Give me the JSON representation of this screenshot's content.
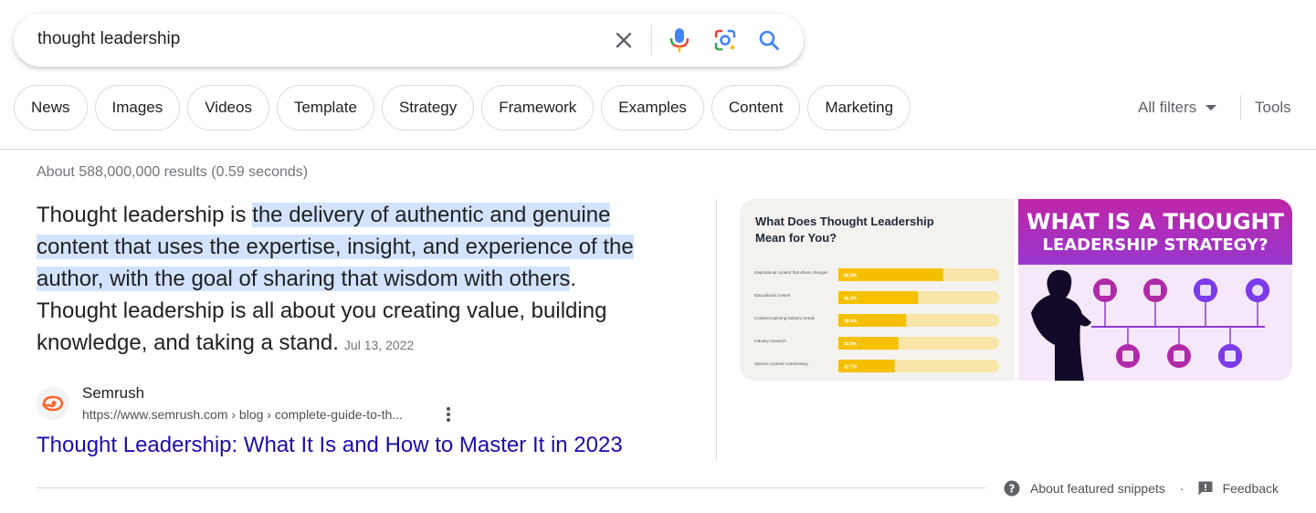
{
  "search": {
    "query": "thought leadership"
  },
  "chips": [
    "News",
    "Images",
    "Videos",
    "Template",
    "Strategy",
    "Framework",
    "Examples",
    "Content",
    "Marketing"
  ],
  "toolbar": {
    "all_filters": "All filters",
    "tools": "Tools"
  },
  "results_stats": "About 588,000,000 results (0.59 seconds)",
  "snippet": {
    "intro": "Thought leadership is ",
    "highlight_1": "the delivery of authentic and genuine",
    "highlight_2": "content that uses the expertise, insight, and experience of the",
    "highlight_3": "author, with the goal of sharing that wisdom with others",
    "after_highlight": ".",
    "line_4": "Thought leadership is all about you creating value, building",
    "line_5": "knowledge, and taking a stand.",
    "date": "Jul 13, 2022"
  },
  "source": {
    "site_name": "Semrush",
    "url": "https://www.semrush.com › blog › complete-guide-to-th...",
    "title": "Thought Leadership: What It Is and How to Master It in 2023"
  },
  "image_left": {
    "heading": "What Does Thought Leadership Mean for You?",
    "bars": [
      {
        "label": "Inspirational content that drives changes",
        "value": "60.9%",
        "pct": 60.9
      },
      {
        "label": "Educational content",
        "value": "46.3%",
        "pct": 46.3
      },
      {
        "label": "Content exploring industry trends",
        "value": "39.4%",
        "pct": 39.4
      },
      {
        "label": "Industry research",
        "value": "34.9%",
        "pct": 34.9
      },
      {
        "label": "Opinion content/ commentary",
        "value": "32.7%",
        "pct": 32.7
      }
    ]
  },
  "image_right": {
    "heading_line_1": "WHAT IS A THOUGHT",
    "heading_line_2": "LEADERSHIP STRATEGY?"
  },
  "footer": {
    "about": "About featured snippets",
    "separator": "·",
    "feedback": "Feedback"
  },
  "colors": {
    "link": "#1a0dab",
    "highlight": "#d3e3fd",
    "bar_fill": "#f5c000",
    "bar_track": "#f8e6a8"
  },
  "icons": [
    "clear-icon",
    "microphone-icon",
    "lens-icon",
    "search-icon",
    "caret-down-icon",
    "semrush-favicon",
    "more-vert-icon",
    "help-icon",
    "feedback-icon"
  ]
}
